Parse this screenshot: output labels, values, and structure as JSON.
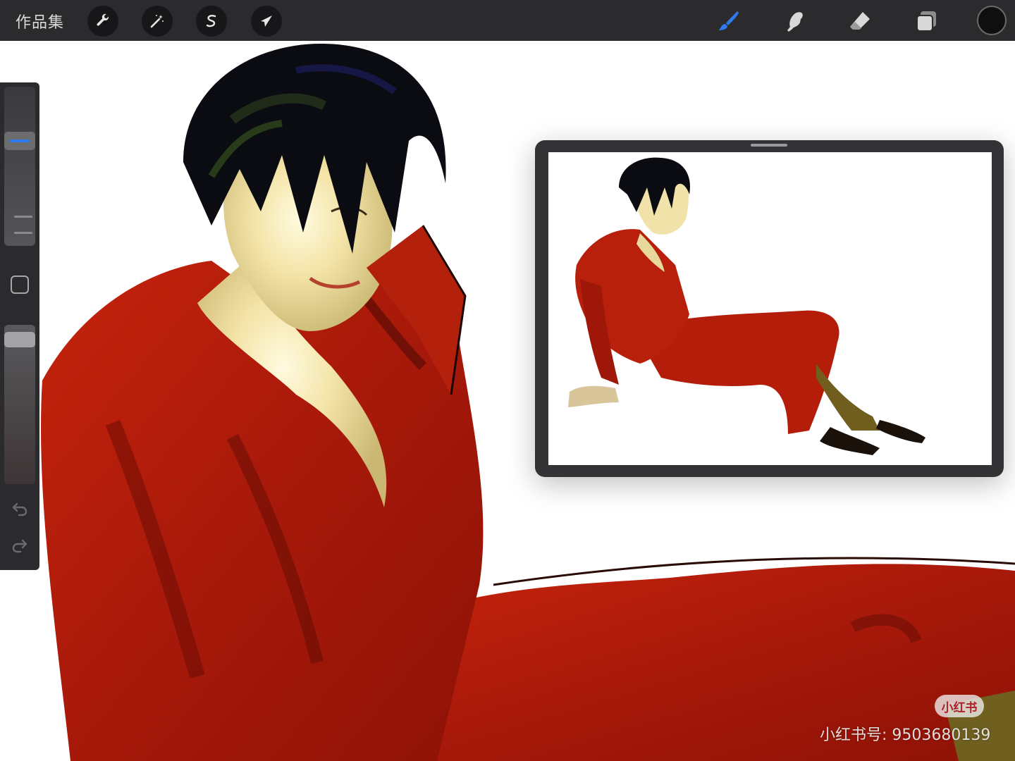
{
  "topbar": {
    "gallery_label": "作品集",
    "left_tools": [
      {
        "name": "actions",
        "icon": "wrench-icon"
      },
      {
        "name": "adjustments",
        "icon": "magic-wand-icon"
      },
      {
        "name": "selection",
        "icon": "selection-s-icon"
      },
      {
        "name": "transform",
        "icon": "arrow-cursor-icon"
      }
    ],
    "right_tools": [
      {
        "name": "brush",
        "icon": "brush-icon",
        "active": true
      },
      {
        "name": "smudge",
        "icon": "smudge-finger-icon",
        "active": false
      },
      {
        "name": "eraser",
        "icon": "eraser-icon",
        "active": false
      },
      {
        "name": "layers",
        "icon": "layers-icon",
        "active": false
      }
    ],
    "current_color": "#0f0f10",
    "accent_color": "#2e7bf0"
  },
  "sidebar": {
    "brush_size_level": 0.68,
    "brush_opacity_level": 0.95,
    "buttons": [
      {
        "name": "modify",
        "icon": "square-modify-icon"
      },
      {
        "name": "undo",
        "icon": "undo-icon"
      },
      {
        "name": "redo",
        "icon": "redo-icon"
      }
    ]
  },
  "reference": {
    "panel": "reference-window"
  },
  "watermark": {
    "badge": "小红书",
    "text": "小红书号: 9503680139"
  }
}
